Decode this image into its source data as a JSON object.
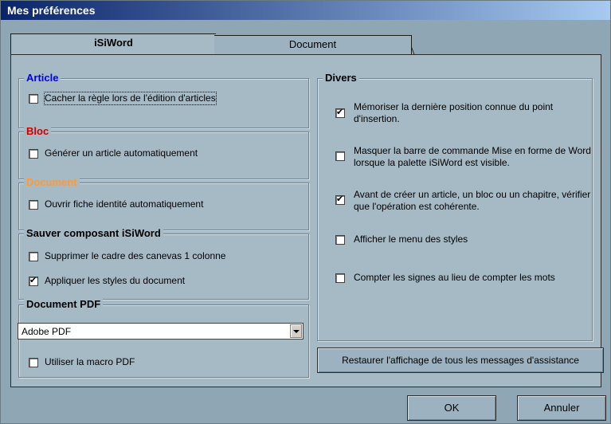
{
  "window": {
    "title": "Mes préférences"
  },
  "tabs": [
    {
      "label": "iSiWord",
      "active": true
    },
    {
      "label": "Document",
      "active": false
    }
  ],
  "groups": {
    "article": {
      "title": "Article",
      "title_color": "#0000ff",
      "items": [
        {
          "label": "Cacher la règle lors de l'édition d'articles",
          "checked": false
        }
      ]
    },
    "bloc": {
      "title": "Bloc",
      "title_color": "#cc0000",
      "items": [
        {
          "label": "Générer un article automatiquement",
          "checked": false
        }
      ]
    },
    "document": {
      "title": "Document",
      "title_color": "#ff9933",
      "items": [
        {
          "label": "Ouvrir fiche identité automatiquement",
          "checked": false
        }
      ]
    },
    "sauver": {
      "title": "Sauver composant iSiWord",
      "items": [
        {
          "label": "Supprimer le cadre des canevas 1 colonne",
          "checked": false
        },
        {
          "label": "Appliquer les styles du document",
          "checked": true
        }
      ]
    },
    "pdf": {
      "title": "Document PDF",
      "select_value": "Adobe PDF",
      "items": [
        {
          "label": "Utiliser la macro PDF",
          "checked": false
        }
      ]
    },
    "divers": {
      "title": "Divers",
      "items": [
        {
          "label": "Mémoriser la dernière position connue du point d'insertion.",
          "checked": true
        },
        {
          "label": "Masquer la barre de commande  Mise en forme de Word lorsque la palette iSiWord est visible.",
          "checked": false
        },
        {
          "label": "Avant de créer un article, un bloc ou un chapitre, vérifier que l'opération est cohérente.",
          "checked": true
        },
        {
          "label": "Afficher le menu des styles",
          "checked": false
        },
        {
          "label": "Compter les signes au lieu de compter les mots",
          "checked": false
        }
      ]
    }
  },
  "buttons": {
    "restore": "Restaurer l'affichage de tous les messages d'assistance",
    "ok": "OK",
    "cancel": "Annuler"
  }
}
